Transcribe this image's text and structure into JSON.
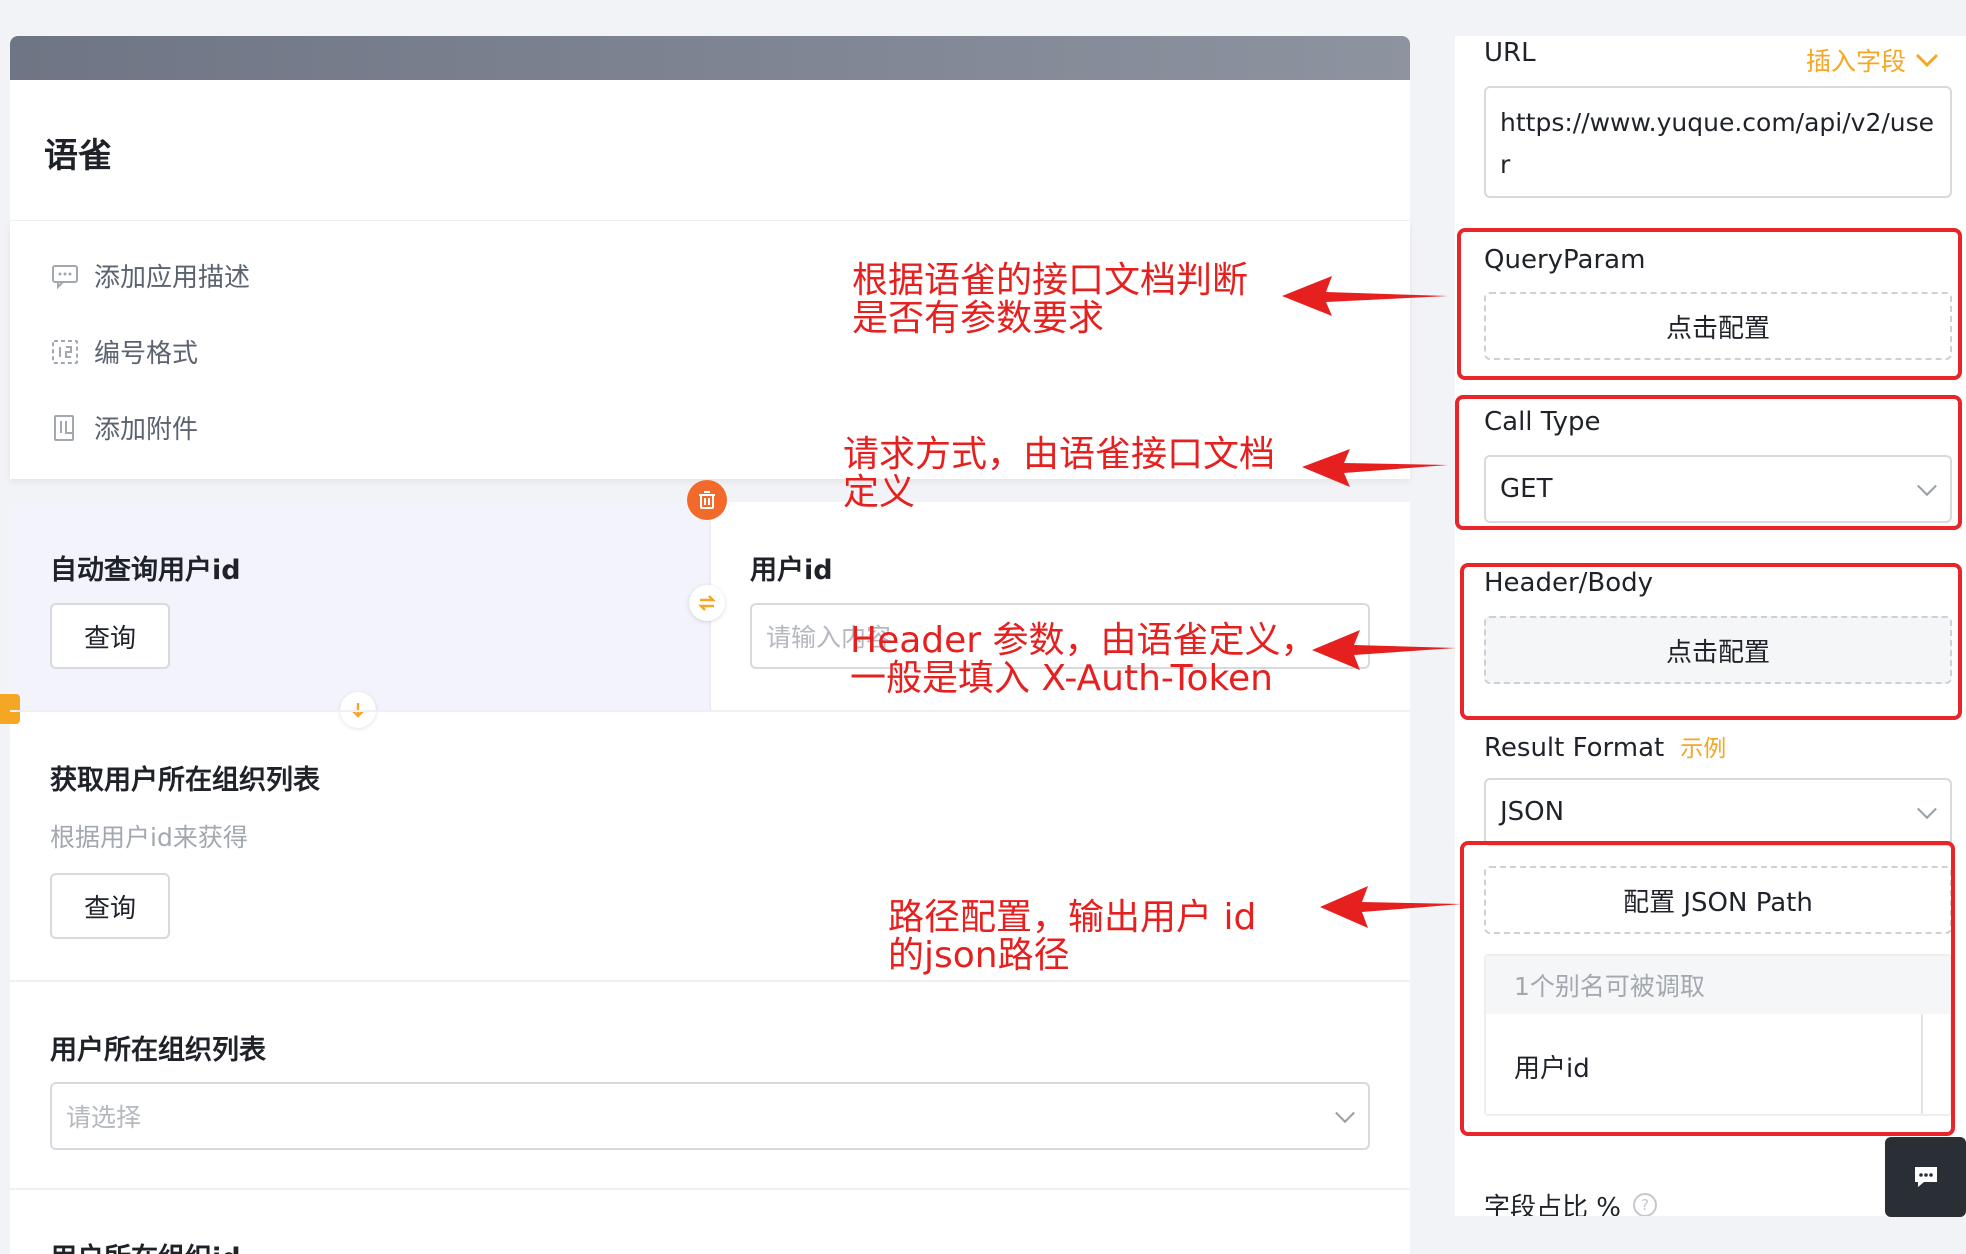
{
  "app": {
    "title": "语雀"
  },
  "meta_items": [
    {
      "label": "添加应用描述",
      "icon": "comment-icon"
    },
    {
      "label": "编号格式",
      "icon": "number-format-icon"
    },
    {
      "label": "添加附件",
      "icon": "attachment-icon"
    }
  ],
  "nodes": {
    "auto_query": {
      "title": "自动查询用户id",
      "button": "查询"
    },
    "user_id": {
      "title": "用户id",
      "placeholder": "请输入内容"
    },
    "org_list_query": {
      "title": "获取用户所在组织列表",
      "subtitle": "根据用户id来获得",
      "button": "查询"
    },
    "org_list_select": {
      "title": "用户所在组织列表",
      "placeholder": "请选择"
    },
    "org_id": {
      "title": "用户所在组织id"
    }
  },
  "right_panel": {
    "url": {
      "label": "URL",
      "insert_field": "插入字段",
      "value": "https://www.yuque.com/api/v2/user"
    },
    "query_param": {
      "label": "QueryParam",
      "button": "点击配置"
    },
    "call_type": {
      "label": "Call Type",
      "value": "GET"
    },
    "header_body": {
      "label": "Header/Body",
      "button": "点击配置"
    },
    "result_format": {
      "label": "Result Format",
      "example": "示例",
      "value": "JSON"
    },
    "json_path": {
      "button": "配置 JSON Path",
      "alias_header": "1个别名可被调取",
      "alias_item": "用户id"
    },
    "field_ratio": {
      "label": "字段占比 %"
    }
  },
  "annotations": [
    {
      "text_line1": "根据语雀的接口文档判断",
      "text_line2": "是否有参数要求"
    },
    {
      "text_line1": "请求方式，由语雀接口文档",
      "text_line2": "定义"
    },
    {
      "text_line1": "Header 参数，由语雀定义，",
      "text_line2": "一般是填入 X-Auth-Token"
    },
    {
      "text_line1": "路径配置，输出用户 id",
      "text_line2": "的json路径"
    }
  ],
  "colors": {
    "annotation_red": "#e5201f",
    "accent_orange": "#f5a623",
    "delete_orange": "#f26a2a"
  }
}
